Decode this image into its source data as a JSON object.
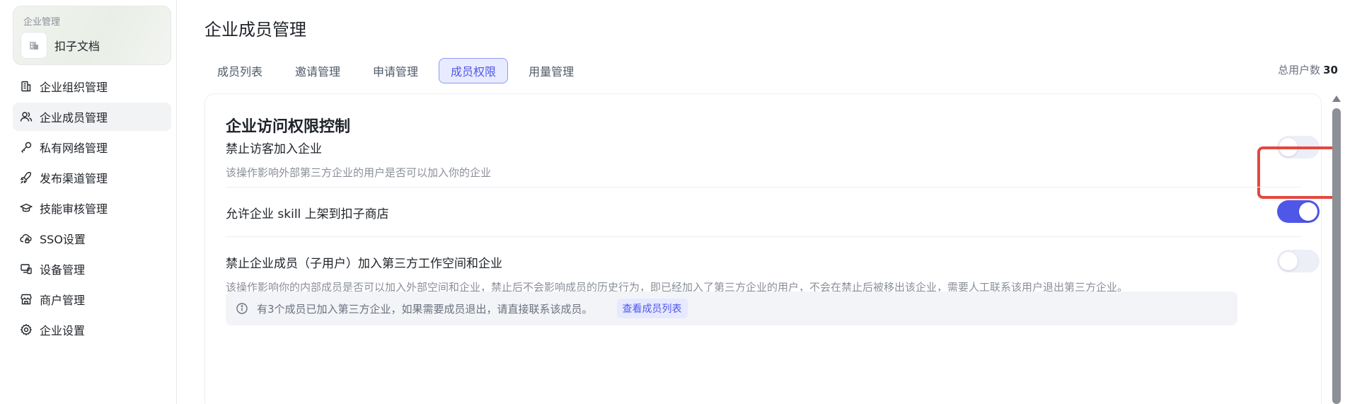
{
  "sidebar": {
    "org_caption": "企业管理",
    "org_name": "扣子文档",
    "items": [
      {
        "label": "企业组织管理",
        "icon": "building-icon"
      },
      {
        "label": "企业成员管理",
        "icon": "users-icon"
      },
      {
        "label": "私有网络管理",
        "icon": "key-icon"
      },
      {
        "label": "发布渠道管理",
        "icon": "rocket-icon"
      },
      {
        "label": "技能审核管理",
        "icon": "graduation-cap-icon"
      },
      {
        "label": "SSO设置",
        "icon": "cloud-lock-icon"
      },
      {
        "label": "设备管理",
        "icon": "devices-icon"
      },
      {
        "label": "商户管理",
        "icon": "store-icon"
      },
      {
        "label": "企业设置",
        "icon": "gear-icon"
      }
    ],
    "active_index": 1
  },
  "header": {
    "title": "企业成员管理",
    "user_count_label": "总用户数",
    "user_count_value": "30"
  },
  "tabs": [
    {
      "label": "成员列表"
    },
    {
      "label": "邀请管理"
    },
    {
      "label": "申请管理"
    },
    {
      "label": "成员权限"
    },
    {
      "label": "用量管理"
    }
  ],
  "active_tab_index": 3,
  "panel": {
    "title": "企业访问权限控制",
    "settings": [
      {
        "title": "禁止访客加入企业",
        "desc": "该操作影响外部第三方企业的用户是否可以加入你的企业",
        "enabled": false
      },
      {
        "title": "允许企业 skill 上架到扣子商店",
        "desc": "",
        "enabled": true
      },
      {
        "title": "禁止企业成员（子用户）加入第三方工作空间和企业",
        "desc": "该操作影响你的内部成员是否可以加入外部空间和企业，禁止后不会影响成员的历史行为，即已经加入了第三方企业的用户，不会在禁止后被移出该企业，需要人工联系该用户退出第三方企业。",
        "enabled": false
      }
    ],
    "notice": {
      "text": "有3个成员已加入第三方企业，如果需要成员退出，请直接联系该成员。",
      "link_label": "查看成员列表"
    }
  },
  "colors": {
    "accent": "#4f57e8",
    "highlight": "#e4473f",
    "toggle_off": "#eceef8"
  }
}
